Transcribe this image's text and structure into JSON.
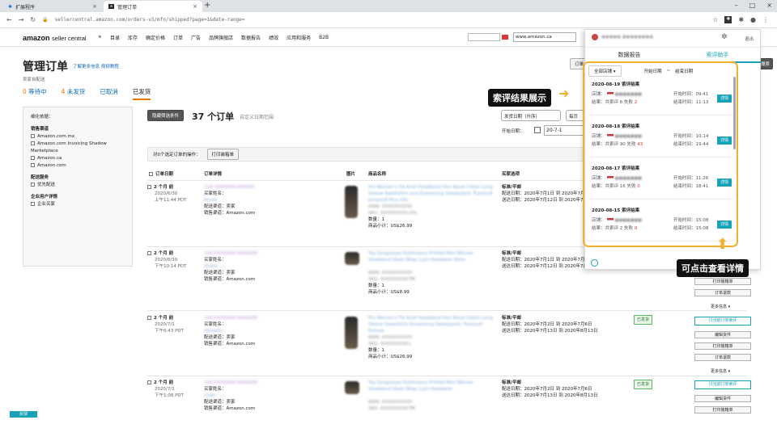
{
  "browser": {
    "tabs": [
      {
        "label": "扩展程序"
      },
      {
        "label": "管理订单"
      }
    ],
    "url": "sellercentral.amazon.com/orders-v3/mfn/shipped?page=1&date-range="
  },
  "amazon": {
    "logo_main": "amazon",
    "logo_sub": "seller central",
    "nav": [
      "目录",
      "库存",
      "确定价格",
      "订单",
      "广告",
      "品牌旗舰店",
      "数据报告",
      "绩效",
      "应用和服务",
      "B2B"
    ],
    "marketplace": "www.amazon.ca"
  },
  "page": {
    "title": "管理订单",
    "title_links": "了解更多信息  视频教程",
    "subtitle": "卖家自配送",
    "tabs": [
      {
        "count": "0",
        "label": "等待中"
      },
      {
        "count": "4",
        "label": "未发货"
      },
      {
        "count": "",
        "label": "已取消"
      },
      {
        "count": "",
        "label": "已发货"
      }
    ],
    "hide_filters_btn": "隐藏筛选条件",
    "orders_count": "37 个订单",
    "custom_date": "自定义日期范围",
    "sort": "发货日期（升序）",
    "sort2": "每页",
    "start_date_label": "开始日期：",
    "start_date_value": "20-7-1",
    "bulk_text": "对0个选定订单的操作：",
    "print_slip": "打印装箱单"
  },
  "filters": {
    "title": "细化依据：",
    "sections": [
      {
        "heading": "销售渠道",
        "items": [
          "Amazon.com.mx",
          "Amazon.com Invoicing Shadow Marketplace",
          "Amazon.ca",
          "Amazon.com"
        ]
      },
      {
        "heading": "配送服务",
        "items": [
          "优先配送"
        ]
      },
      {
        "heading": "企业用户详情",
        "items": [
          "企业买家"
        ]
      }
    ]
  },
  "columns": [
    "订单日期",
    "订单详情",
    "图片",
    "商品名称",
    "买家选项"
  ],
  "orders": [
    {
      "age": "2 个月 前",
      "date": "2020/6/30",
      "time": "上午11:44 PDT",
      "buyer_label": "买家姓名：",
      "channel": "配送渠道：卖家",
      "sales_channel": "销售渠道：Amazon.com",
      "order_id": "114-7XXXXXX-XXXXXX",
      "buyer": "Annie",
      "title": "Pro Women's Tie Knot Headband Hair Band Cotton Long Sleeve Sweatshirt and Drawstring Sweatpants Tracksuit Jumpsuit Plus XXL",
      "asin": "ASIN: XXXXXXXXXX",
      "sku": "SKU: XXXXXXXXX-2XL",
      "qty": "数量：1",
      "subtotal": "商品小计：US$26.99",
      "ship": "标准/平邮",
      "ship_date": "配送日期：2020年7月1日 到 2020年7月",
      "deliver_date": "送达日期：2020年7月12日 到 2020年7月",
      "shipped_badge": ""
    },
    {
      "age": "2 个月 前",
      "date": "2020/6/30",
      "time": "下午10:14 PDT",
      "buyer_label": "买家姓名：",
      "channel": "配送渠道：卖家",
      "sales_channel": "销售渠道：Amazon.com",
      "order_id": "114-XXXXXXX-XXXXXXX",
      "buyer": "Zhaoh",
      "title": "Top Sunglasses Extensions Printed Mini Women Headband Head Wrap Cyril Headwear Boho",
      "asin": "ASIN: XXXXXXXXXX",
      "sku": "SKU: XXXXXXXXX-TM",
      "qty": "数量：1",
      "subtotal": "商品小计：US$8.99",
      "ship": "标准/平邮",
      "ship_date": "配送日期：2020年7月1日 到 2020年7月",
      "deliver_date": "送达日期：2020年7月12日 到 2020年7月",
      "shipped_badge": ""
    },
    {
      "age": "2 个月 前",
      "date": "2020/7/1",
      "time": "下午6:43 PDT",
      "buyer_label": "买家姓名：",
      "channel": "配送渠道：卖家",
      "sales_channel": "销售渠道：Amazon.com",
      "order_id": "114-XXXXXXX-XXXXXXX",
      "buyer": "Danielle",
      "title": "Pro Women's Tie Knot Headband Hair Band Cotton Long Sleeve Sweatshirt Drawstring Sweatpants Tracksuit Female",
      "asin": "ASIN: XXXXXXXXXX",
      "sku": "SKU: XXXXXXXXX-L",
      "qty": "数量：1",
      "subtotal": "商品小计：US$26.99",
      "ship": "标准/平邮",
      "ship_date": "配送日期：2020年7月2日 到 2020年7月6日",
      "deliver_date": "送达日期：2020年7月13日 到 2020年8月13日",
      "shipped_badge": "已发货"
    },
    {
      "age": "2 个月 前",
      "date": "2020/7/1",
      "time": "下午1:08 PDT",
      "buyer_label": "买家姓名：",
      "channel": "配送渠道：卖家",
      "sales_channel": "销售渠道：Amazon.com",
      "order_id": "114-XXXXXXX-XXXXXXX",
      "buyer": "Chen",
      "title": "Top Sunglasses Extensions Printed Mini Women Headband Head Wrap Cyril Headwear",
      "asin": "ASIN: XXXXXXXXXX",
      "sku": "SKU: XXXXXXXXX-TM",
      "qty": "",
      "subtotal": "",
      "ship": "标准/平邮",
      "ship_date": "配送日期：2020年7月2日 到 2020年7月6日",
      "deliver_date": "送达日期：2020年7月13日 到 2020年8月13日",
      "shipped_badge": "已发货"
    }
  ],
  "actions": {
    "print_slip": "打印装箱单",
    "refund": "订单退款",
    "more": "更多信息 ▾",
    "review": "讨当前订单索评",
    "edit": "编辑货件",
    "print_slip2": "打印装箱单",
    "refund2": "订单退款"
  },
  "popup": {
    "tab_report": "数据报告",
    "tab_helper": "索评助手",
    "logout": "退出",
    "filter_store": "全部店铺 ▾",
    "filter_start": "开始日期",
    "filter_sep": "~",
    "filter_end": "结束日期",
    "results": [
      {
        "date": "2020-08-19 索评结果",
        "shop_label": "店铺：",
        "start_label": "开始时间：",
        "start": "09:41",
        "result": "结果：共索评 6 失败 ",
        "failed": "2",
        "end_label": "结束时间：",
        "end": "11:13",
        "detail": "详情"
      },
      {
        "date": "2020-08-18 索评结果",
        "shop_label": "店铺：",
        "start_label": "开始时间：",
        "start": "10:14",
        "result": "结果：共索评 90 失败 ",
        "failed": "43",
        "end_label": "结束时间：",
        "end": "19:44",
        "detail": "详情"
      },
      {
        "date": "2020-08-17 索评结果",
        "shop_label": "店铺：",
        "start_label": "开始时间：",
        "start": "11:26",
        "result": "结果：共索评 16 失败 ",
        "failed": "0",
        "end_label": "结束时间：",
        "end": "18:41",
        "detail": "详情"
      },
      {
        "date": "2020-08-15 索评结果",
        "shop_label": "店铺：",
        "start_label": "开始时间：",
        "start": "15:08",
        "result": "结果：共索评 2 失败 ",
        "failed": "0",
        "end_label": "结束时间：",
        "end": "15:08",
        "detail": "详情"
      }
    ]
  },
  "callouts": {
    "results": "索评结果展示",
    "details": "可点击查看详情"
  },
  "right_header": {
    "a": "设置",
    "b": "订单",
    "c": "搜索"
  },
  "bottom_tag": "反馈"
}
